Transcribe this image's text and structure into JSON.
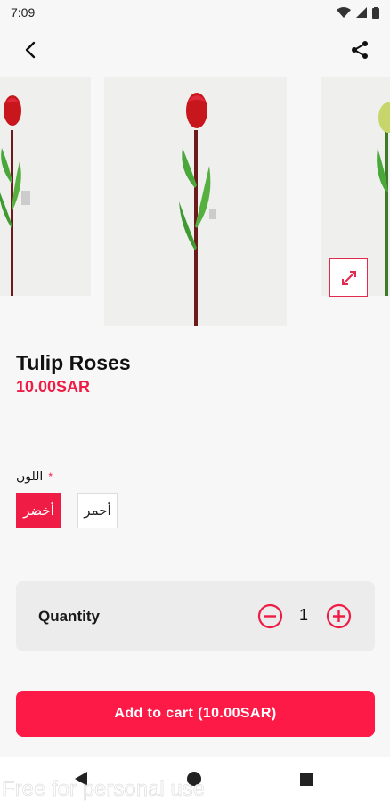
{
  "status_bar": {
    "time": "7:09"
  },
  "product": {
    "title": "Tulip Roses",
    "price": "10.00SAR"
  },
  "options": {
    "color_label": "اللون",
    "required_mark": "*",
    "choices": [
      {
        "label": "أخضر",
        "selected": true
      },
      {
        "label": "أحمر",
        "selected": false
      }
    ]
  },
  "quantity": {
    "label": "Quantity",
    "value": "1"
  },
  "cart": {
    "add_label": "Add to cart (10.00SAR)"
  },
  "watermark": "Free for personal use",
  "colors": {
    "accent": "#fe1a47",
    "price": "#ef1c45"
  },
  "icons": [
    "back-arrow-icon",
    "share-icon",
    "expand-icon",
    "minus-circle-icon",
    "plus-circle-icon",
    "nav-back-icon",
    "nav-home-icon",
    "nav-recents-icon"
  ]
}
